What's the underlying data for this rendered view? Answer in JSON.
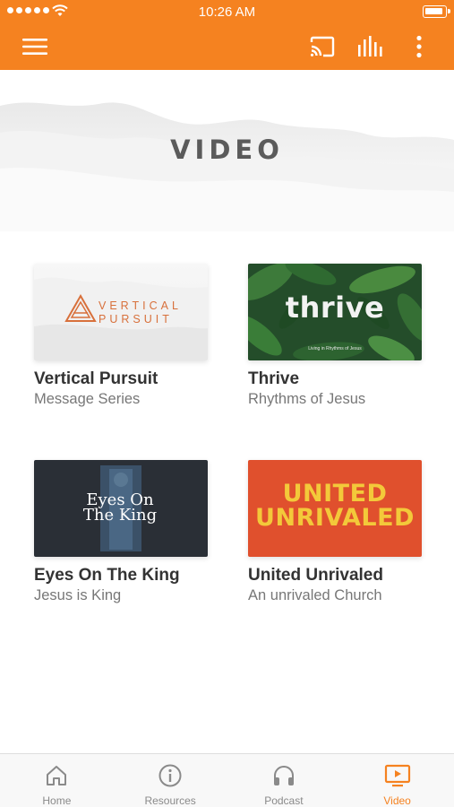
{
  "status_bar": {
    "time": "10:26 AM"
  },
  "app_bar": {
    "background": "#F58220",
    "icons": [
      "menu-icon",
      "cast-icon",
      "equalizer-icon",
      "more-vertical-icon"
    ]
  },
  "hero": {
    "title": "VIDEO"
  },
  "cards": [
    {
      "title": "Vertical Pursuit",
      "subtitle": "Message Series",
      "thumb_lines": [
        "VERTICAL",
        "PURSUIT"
      ]
    },
    {
      "title": "Thrive",
      "subtitle": "Rhythms of Jesus",
      "thumb_word": "thrive",
      "thumb_tag": "Living in Rhythms of Jesus"
    },
    {
      "title": "Eyes On The King",
      "subtitle": "Jesus is King",
      "thumb_lines": [
        "Eyes On",
        "The King"
      ]
    },
    {
      "title": "United Unrivaled",
      "subtitle": "An unrivaled Church",
      "thumb_lines": [
        "UNITED",
        "UNRIVALED"
      ]
    }
  ],
  "tabbar": {
    "active_color": "#F58220",
    "tabs": [
      {
        "label": "Home",
        "icon": "home-icon"
      },
      {
        "label": "Resources",
        "icon": "info-icon"
      },
      {
        "label": "Podcast",
        "icon": "headphones-icon"
      },
      {
        "label": "Video",
        "icon": "tv-play-icon",
        "active": true
      }
    ]
  }
}
